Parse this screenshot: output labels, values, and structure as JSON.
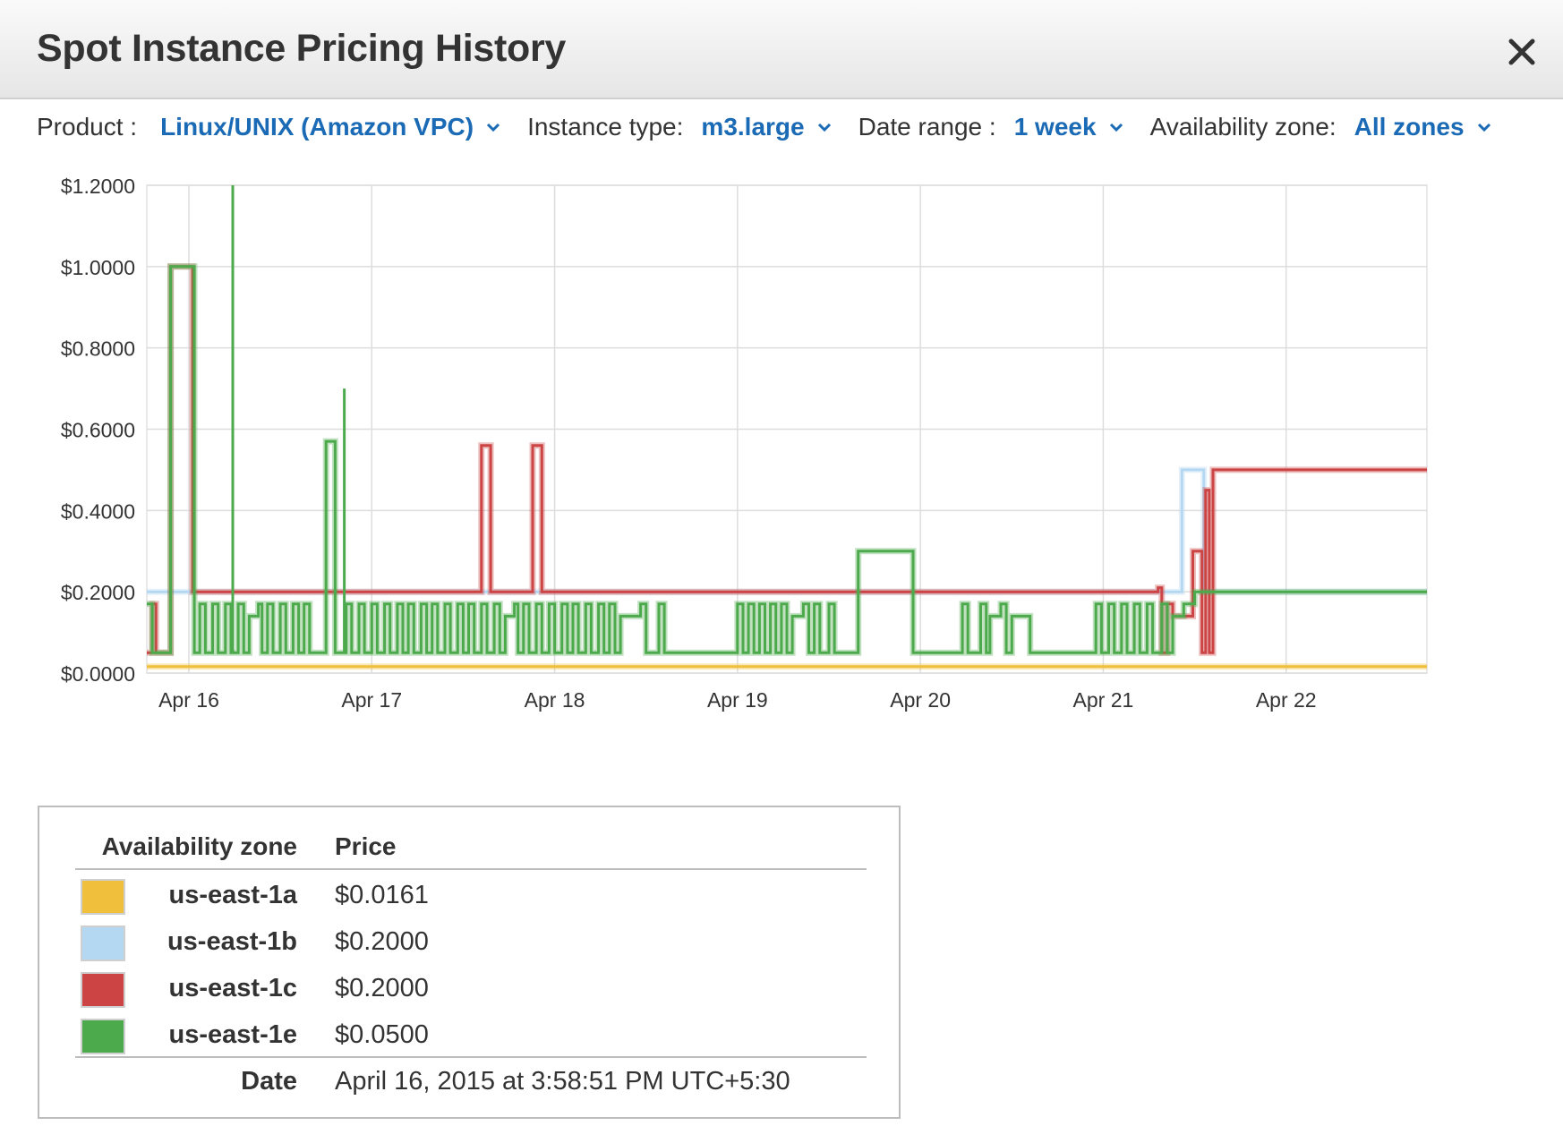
{
  "dialog": {
    "title": "Spot Instance Pricing History",
    "close_icon": "close-icon"
  },
  "filters": {
    "product_label": "Product :",
    "product_value": "Linux/UNIX (Amazon VPC)",
    "instance_type_label": "Instance type:",
    "instance_type_value": "m3.large",
    "date_range_label": "Date range :",
    "date_range_value": "1 week",
    "availability_zone_label": "Availability zone:",
    "availability_zone_value": "All zones",
    "dropdown_icon": "chevron-down-icon"
  },
  "chart_data": {
    "type": "line",
    "step": true,
    "grid": true,
    "xlim": [
      15.77,
      22.77
    ],
    "ylim": [
      0,
      1.2
    ],
    "x_tick_values": [
      16,
      17,
      18,
      19,
      20,
      21,
      22
    ],
    "x_tick_labels": [
      "Apr 16",
      "Apr 17",
      "Apr 18",
      "Apr 19",
      "Apr 20",
      "Apr 21",
      "Apr 22"
    ],
    "y_tick_values": [
      0,
      0.2,
      0.4,
      0.6,
      0.8,
      1.0,
      1.2
    ],
    "y_tick_labels": [
      "$0.0000",
      "$0.2000",
      "$0.4000",
      "$0.6000",
      "$0.8000",
      "$1.0000",
      "$1.2000"
    ],
    "series": [
      {
        "name": "us-east-1a",
        "color": "#f0c03c",
        "x": [
          15.77,
          22.77
        ],
        "y": [
          0.0161,
          0.0161
        ]
      },
      {
        "name": "us-east-1b",
        "color": "#b5d8f2",
        "x": [
          15.77,
          21.41,
          21.43,
          21.53,
          21.55,
          22.77
        ],
        "y": [
          0.2,
          0.2,
          0.5,
          0.5,
          0.2,
          0.2
        ]
      },
      {
        "name": "us-east-1c",
        "color": "#cc4444",
        "x": [
          15.77,
          15.85,
          15.87,
          15.93,
          15.96,
          16.08,
          16.1,
          17.6,
          17.65,
          17.9,
          17.94,
          21.3,
          21.33,
          21.37,
          21.39,
          21.49,
          21.52,
          21.56,
          21.59,
          21.62,
          22.77
        ],
        "y": [
          0.05,
          0.17,
          0.05,
          1.0,
          1.0,
          1.0,
          0.2,
          0.56,
          0.2,
          0.56,
          0.2,
          0.21,
          0.05,
          0.17,
          0.14,
          0.3,
          0.05,
          0.45,
          0.05,
          0.5,
          0.5
        ],
        "steps": [
          [
            15.77,
            0.05
          ],
          [
            15.8,
            0.17
          ],
          [
            15.82,
            0.05
          ],
          [
            15.9,
            1.0
          ],
          [
            16.02,
            0.2
          ],
          [
            17.6,
            0.56
          ],
          [
            17.65,
            0.2
          ],
          [
            17.88,
            0.56
          ],
          [
            17.93,
            0.2
          ],
          [
            21.3,
            0.21
          ],
          [
            21.32,
            0.05
          ],
          [
            21.35,
            0.17
          ],
          [
            21.38,
            0.14
          ],
          [
            21.49,
            0.3
          ],
          [
            21.54,
            0.05
          ],
          [
            21.56,
            0.45
          ],
          [
            21.58,
            0.05
          ],
          [
            21.6,
            0.5
          ],
          [
            22.77,
            0.5
          ]
        ]
      },
      {
        "name": "us-east-1e",
        "color": "#4caa4c",
        "steps": [
          [
            15.77,
            0.17
          ],
          [
            15.8,
            0.05
          ],
          [
            15.9,
            1.0
          ],
          [
            16.03,
            0.05
          ],
          [
            16.06,
            0.17
          ],
          [
            16.09,
            0.05
          ],
          [
            16.13,
            0.17
          ],
          [
            16.16,
            0.05
          ],
          [
            16.2,
            0.17
          ],
          [
            16.23,
            0.05
          ],
          [
            16.27,
            0.17
          ],
          [
            16.3,
            0.05
          ],
          [
            16.33,
            0.14
          ],
          [
            16.38,
            0.17
          ],
          [
            16.4,
            0.05
          ],
          [
            16.43,
            0.17
          ],
          [
            16.46,
            0.05
          ],
          [
            16.5,
            0.17
          ],
          [
            16.53,
            0.05
          ],
          [
            16.57,
            0.17
          ],
          [
            16.6,
            0.05
          ],
          [
            16.63,
            0.17
          ],
          [
            16.66,
            0.05
          ],
          [
            16.75,
            0.57
          ],
          [
            16.8,
            0.05
          ],
          [
            16.86,
            0.17
          ],
          [
            16.89,
            0.05
          ],
          [
            16.93,
            0.17
          ],
          [
            16.96,
            0.05
          ],
          [
            17.0,
            0.17
          ],
          [
            17.03,
            0.05
          ],
          [
            17.07,
            0.17
          ],
          [
            17.1,
            0.05
          ],
          [
            17.14,
            0.17
          ],
          [
            17.17,
            0.05
          ],
          [
            17.2,
            0.17
          ],
          [
            17.23,
            0.05
          ],
          [
            17.27,
            0.17
          ],
          [
            17.3,
            0.05
          ],
          [
            17.33,
            0.17
          ],
          [
            17.36,
            0.05
          ],
          [
            17.4,
            0.17
          ],
          [
            17.43,
            0.05
          ],
          [
            17.47,
            0.17
          ],
          [
            17.5,
            0.05
          ],
          [
            17.53,
            0.17
          ],
          [
            17.56,
            0.05
          ],
          [
            17.6,
            0.17
          ],
          [
            17.63,
            0.05
          ],
          [
            17.67,
            0.17
          ],
          [
            17.7,
            0.05
          ],
          [
            17.73,
            0.14
          ],
          [
            17.78,
            0.17
          ],
          [
            17.8,
            0.05
          ],
          [
            17.83,
            0.17
          ],
          [
            17.86,
            0.05
          ],
          [
            17.9,
            0.17
          ],
          [
            17.93,
            0.05
          ],
          [
            17.97,
            0.17
          ],
          [
            18.0,
            0.05
          ],
          [
            18.04,
            0.17
          ],
          [
            18.07,
            0.05
          ],
          [
            18.1,
            0.17
          ],
          [
            18.13,
            0.05
          ],
          [
            18.17,
            0.17
          ],
          [
            18.2,
            0.05
          ],
          [
            18.24,
            0.17
          ],
          [
            18.27,
            0.05
          ],
          [
            18.3,
            0.17
          ],
          [
            18.33,
            0.05
          ],
          [
            18.36,
            0.14
          ],
          [
            18.47,
            0.17
          ],
          [
            18.5,
            0.05
          ],
          [
            18.57,
            0.17
          ],
          [
            18.6,
            0.05
          ],
          [
            19.0,
            0.17
          ],
          [
            19.03,
            0.05
          ],
          [
            19.06,
            0.17
          ],
          [
            19.09,
            0.05
          ],
          [
            19.12,
            0.17
          ],
          [
            19.15,
            0.05
          ],
          [
            19.18,
            0.17
          ],
          [
            19.21,
            0.05
          ],
          [
            19.24,
            0.17
          ],
          [
            19.27,
            0.05
          ],
          [
            19.3,
            0.14
          ],
          [
            19.36,
            0.17
          ],
          [
            19.39,
            0.05
          ],
          [
            19.42,
            0.17
          ],
          [
            19.45,
            0.05
          ],
          [
            19.5,
            0.17
          ],
          [
            19.53,
            0.05
          ],
          [
            19.66,
            0.3
          ],
          [
            19.96,
            0.05
          ],
          [
            20.23,
            0.17
          ],
          [
            20.26,
            0.05
          ],
          [
            20.33,
            0.17
          ],
          [
            20.36,
            0.05
          ],
          [
            20.38,
            0.14
          ],
          [
            20.44,
            0.17
          ],
          [
            20.47,
            0.05
          ],
          [
            20.5,
            0.14
          ],
          [
            20.6,
            0.05
          ],
          [
            20.96,
            0.17
          ],
          [
            20.99,
            0.05
          ],
          [
            21.03,
            0.17
          ],
          [
            21.06,
            0.05
          ],
          [
            21.1,
            0.17
          ],
          [
            21.13,
            0.05
          ],
          [
            21.17,
            0.17
          ],
          [
            21.2,
            0.05
          ],
          [
            21.24,
            0.17
          ],
          [
            21.27,
            0.05
          ],
          [
            21.32,
            0.17
          ],
          [
            21.35,
            0.05
          ],
          [
            21.38,
            0.14
          ],
          [
            21.44,
            0.17
          ],
          [
            21.5,
            0.2
          ],
          [
            22.77,
            0.2
          ]
        ],
        "spikes": [
          [
            16.24,
            1.2
          ],
          [
            16.85,
            0.7
          ]
        ]
      }
    ]
  },
  "legend": {
    "zone_header": "Availability zone",
    "price_header": "Price",
    "rows": [
      {
        "zone": "us-east-1a",
        "price": "$0.0161",
        "color": "#f0c03c"
      },
      {
        "zone": "us-east-1b",
        "price": "$0.2000",
        "color": "#b5d8f2"
      },
      {
        "zone": "us-east-1c",
        "price": "$0.2000",
        "color": "#cc4444"
      },
      {
        "zone": "us-east-1e",
        "price": "$0.0500",
        "color": "#4caa4c"
      }
    ],
    "date_label": "Date",
    "date_value": "April 16, 2015 at 3:58:51 PM UTC+5:30"
  }
}
